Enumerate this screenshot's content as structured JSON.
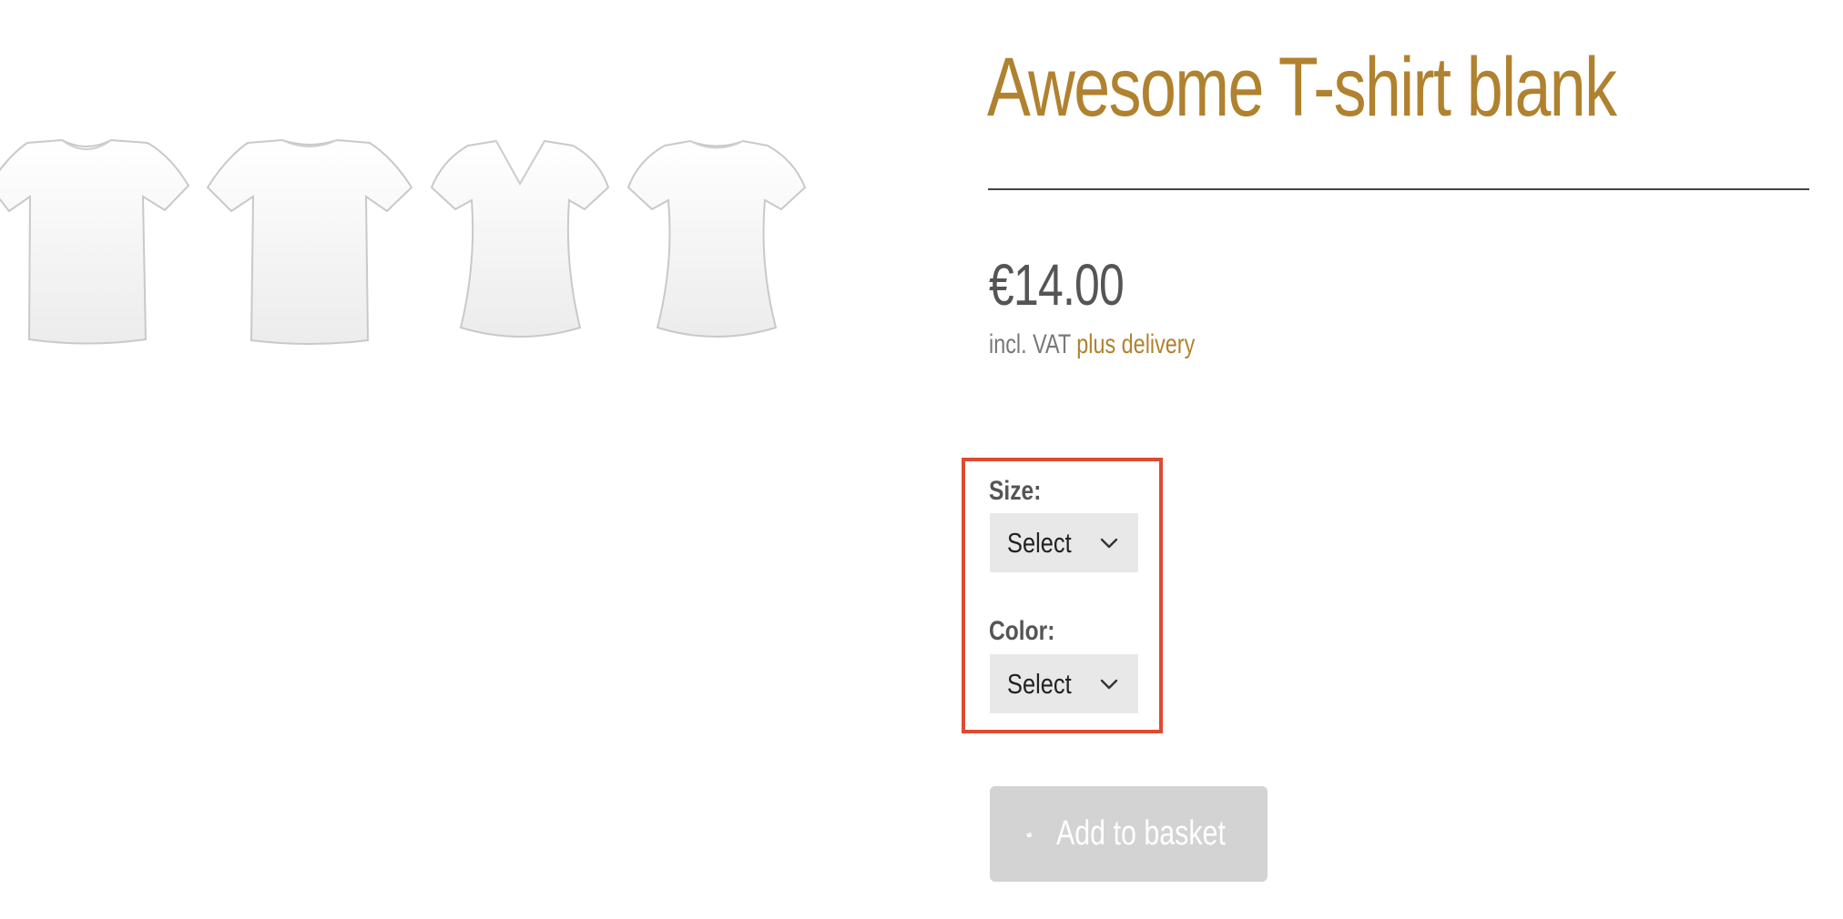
{
  "product": {
    "title": "Awesome T-shirt blank",
    "price": "€14.00",
    "tax_note": "incl. VAT",
    "delivery_link": "plus delivery"
  },
  "variants": {
    "size": {
      "label": "Size:",
      "value": "Select"
    },
    "color": {
      "label": "Color:",
      "value": "Select"
    }
  },
  "basket": {
    "label": "Add to basket",
    "icon": "basket-icon",
    "enabled": false
  },
  "image": {
    "description_icons": [
      "tshirt-crew-icon",
      "tshirt-regular-icon",
      "tshirt-vneck-icon",
      "tshirt-women-icon"
    ]
  },
  "colors": {
    "accent": "#b0822f",
    "highlight_border": "#e04a32",
    "select_bg": "#e8e8e8",
    "button_disabled": "#d3d3d3"
  }
}
